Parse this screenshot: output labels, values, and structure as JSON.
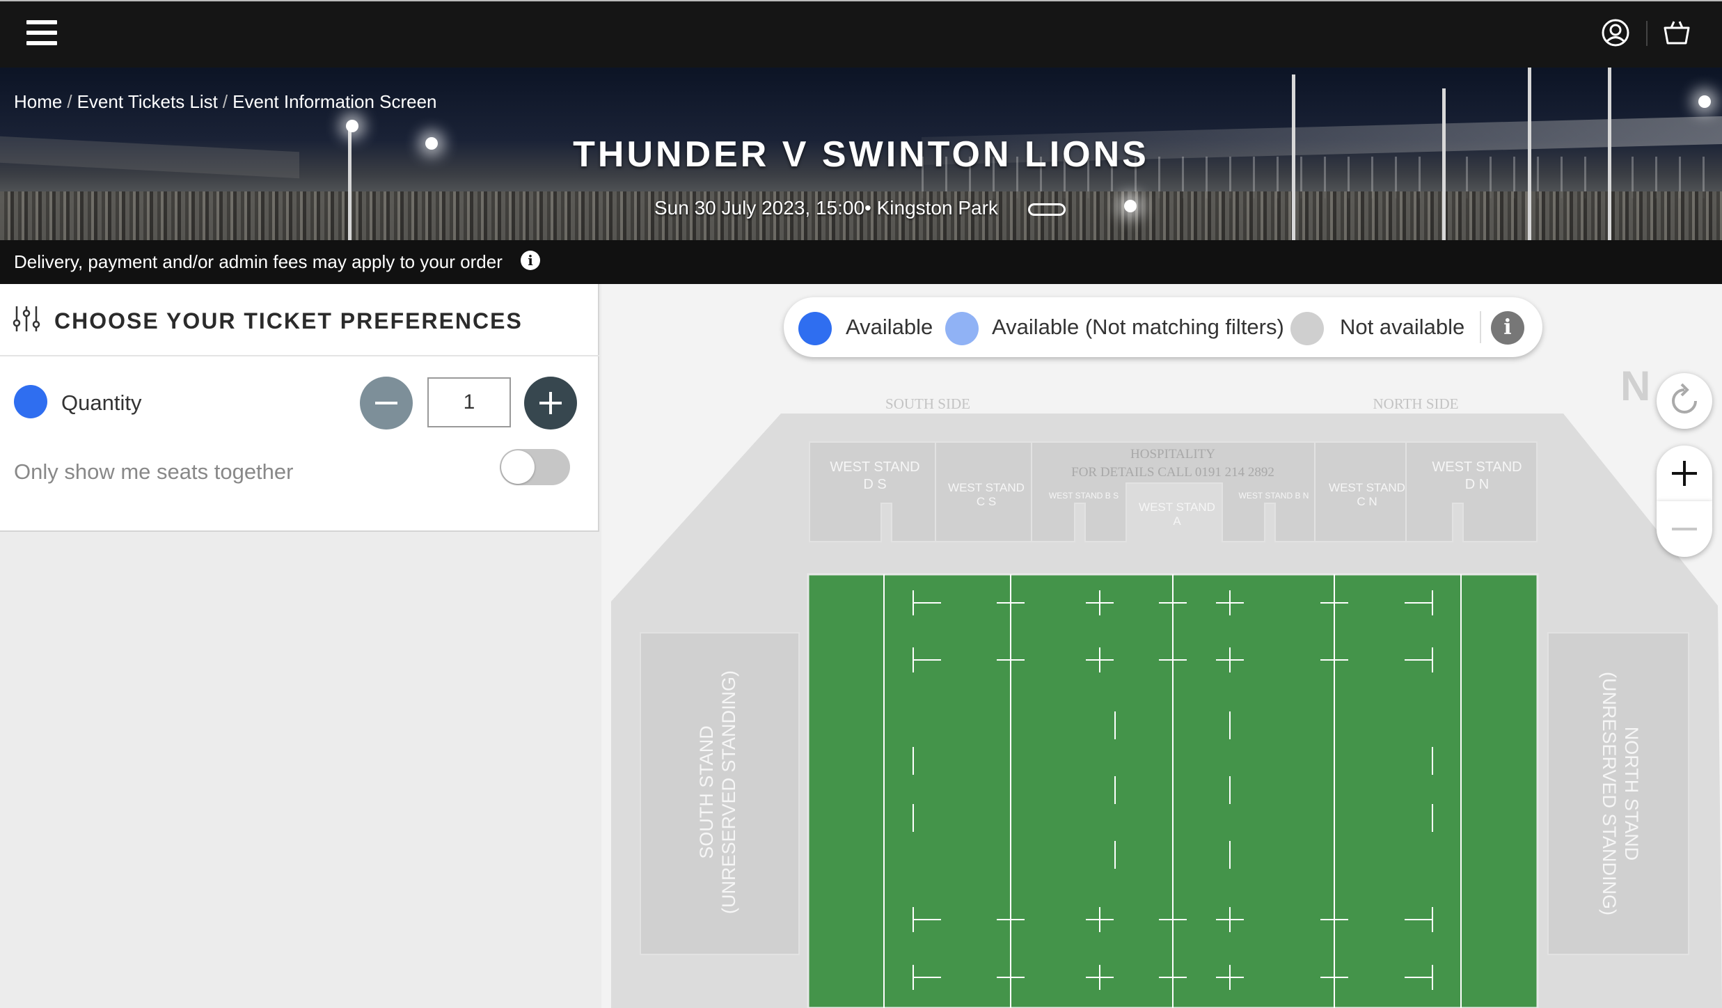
{
  "header": {
    "menu_icon": "hamburger-menu-icon",
    "account_icon": "user-account-icon",
    "basket_icon": "shopping-basket-icon"
  },
  "breadcrumb": {
    "items": [
      "Home",
      "Event Tickets List",
      "Event Information Screen"
    ],
    "separator": "/"
  },
  "event": {
    "title": "THUNDER V SWINTON LIONS",
    "subtitle": "Sun 30 July 2023, 15:00• Kingston Park",
    "link_icon": "link-icon"
  },
  "fees": {
    "text": "Delivery, payment and/or admin fees may apply to your order",
    "info_icon": "info-icon",
    "info_glyph": "i"
  },
  "preferences": {
    "title": "CHOOSE YOUR TICKET PREFERENCES",
    "icon": "sliders-icon",
    "quantity_label": "Quantity",
    "quantity_value": "1",
    "seats_together_label": "Only show me seats together",
    "seats_together_on": false
  },
  "legend": {
    "available": "Available",
    "available_not_matching": "Available (Not matching filters)",
    "not_available": "Not available",
    "info_glyph": "i",
    "colors": {
      "available": "#2f6ef0",
      "not_matching": "#90b2f5",
      "not_available": "#cfcfcf"
    }
  },
  "map": {
    "compass": "N",
    "side_labels": {
      "south": "SOUTH SIDE",
      "north": "NORTH SIDE"
    },
    "stands": {
      "ds": [
        "WEST STAND",
        "D S"
      ],
      "cs": [
        "WEST STAND",
        "C S"
      ],
      "hospitality": [
        "HOSPITALITY",
        "FOR DETAILS CALL 0191 214 2892"
      ],
      "bs": "WEST STAND B S",
      "a": [
        "WEST STAND",
        "A"
      ],
      "bn": "WEST STAND B N",
      "cn": [
        "WEST STAND",
        "C N"
      ],
      "dn": [
        "WEST STAND",
        "D N"
      ],
      "south_stand": [
        "SOUTH STAND",
        "(UNRESERVED STANDING)"
      ],
      "north_stand": [
        "NORTH STAND",
        "(UNRESERVED STANDING)"
      ]
    },
    "controls": {
      "reset_icon": "reset-rotate-icon",
      "zoom_in_icon": "zoom-in-icon",
      "zoom_out_icon": "zoom-out-icon"
    },
    "pitch_color": "#44944a"
  }
}
